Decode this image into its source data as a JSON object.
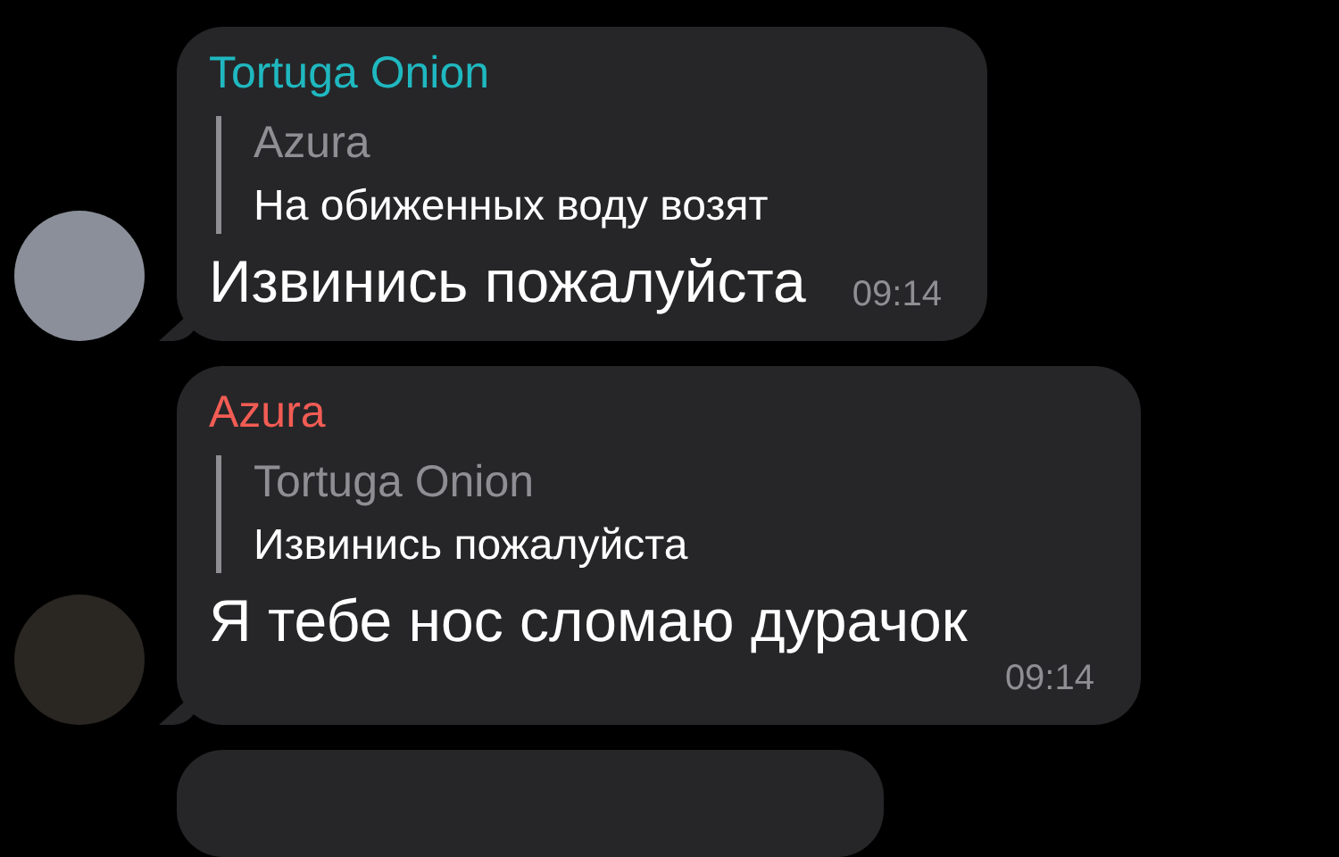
{
  "messages": [
    {
      "sender": "Tortuga Onion",
      "color": "#1fb8c0",
      "reply": {
        "sender": "Azura",
        "text": "На обиженных воду возят"
      },
      "text": "Извинись пожалуйста",
      "time": "09:14"
    },
    {
      "sender": "Azura",
      "color": "#f25c54",
      "reply": {
        "sender": "Tortuga Onion",
        "text": "Извинись пожалуйста"
      },
      "text": "Я тебе нос сломаю дурачок",
      "time": "09:14"
    }
  ]
}
